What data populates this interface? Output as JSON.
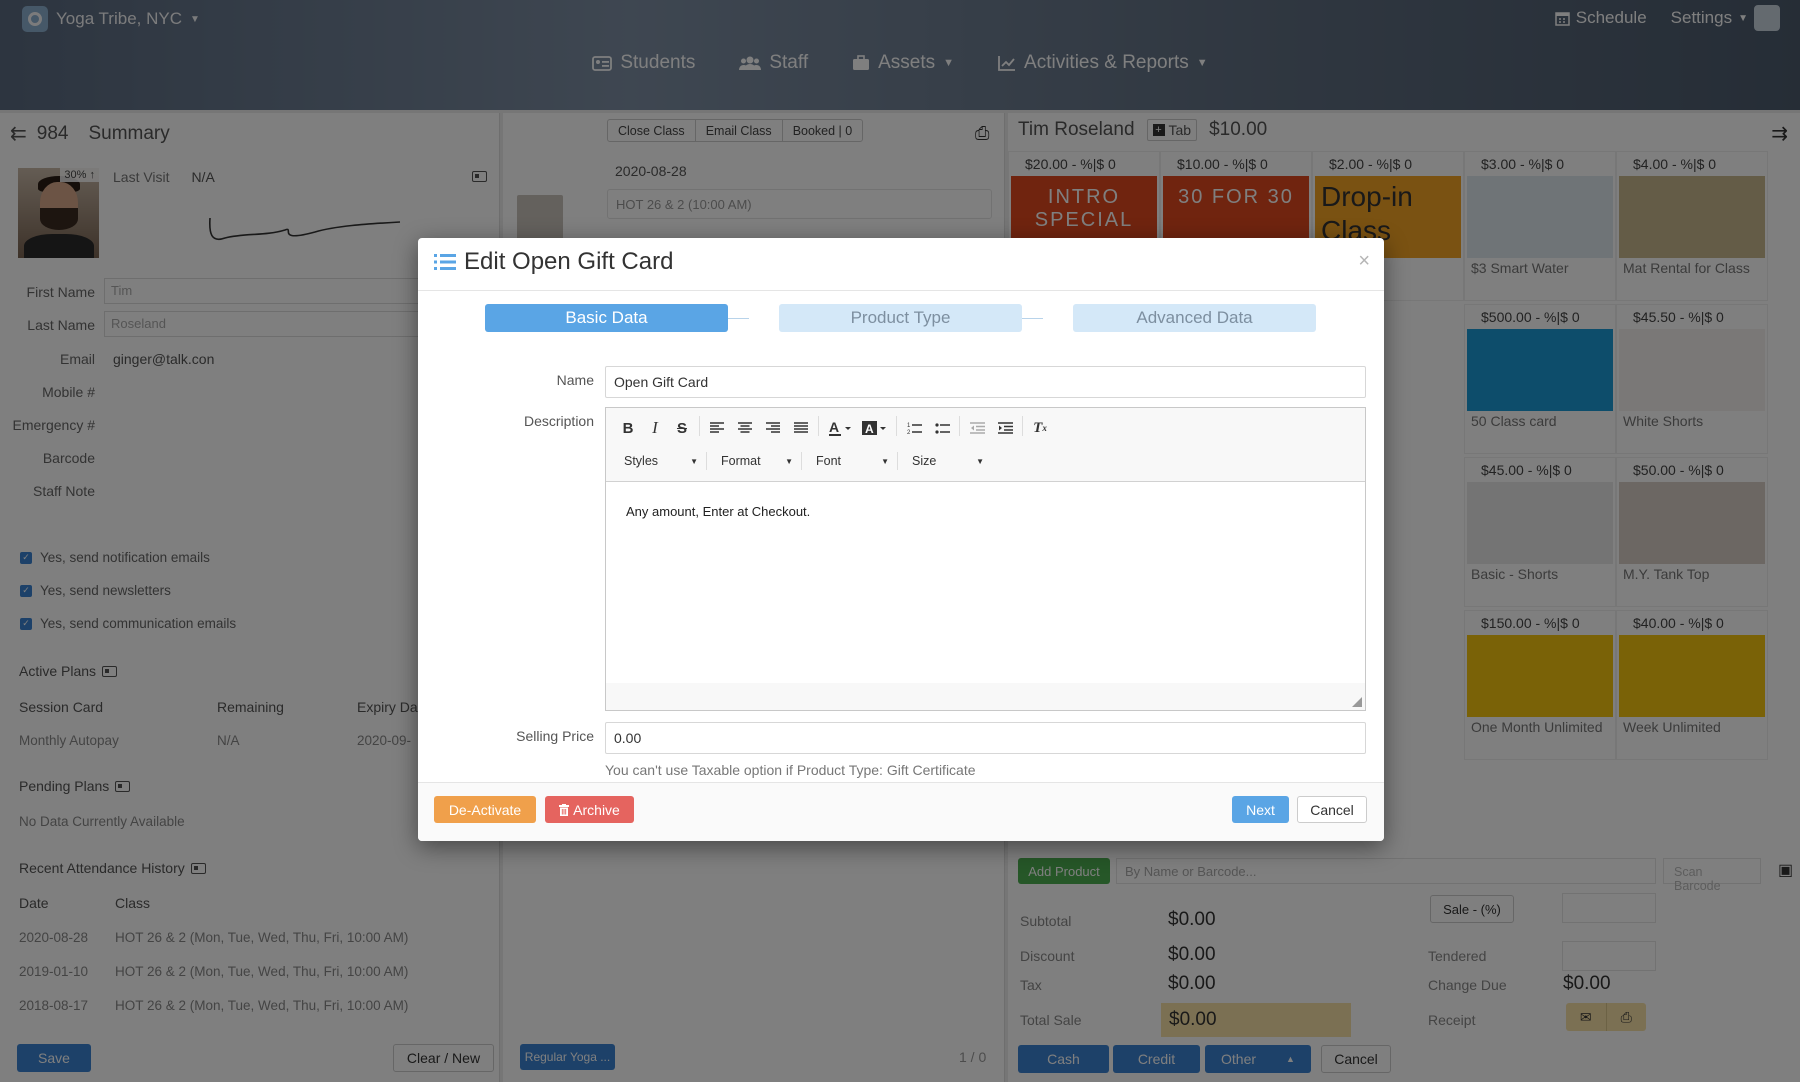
{
  "app": {
    "studio": "Yoga Tribe, NYC",
    "nav": [
      "Students",
      "Staff",
      "Assets",
      "Activities & Reports"
    ],
    "schedule": "Schedule",
    "settings": "Settings"
  },
  "left": {
    "count": "984",
    "title": "Summary",
    "photo_badge": "30%",
    "last_visit_label": "Last Visit",
    "last_visit_value": "N/A",
    "fields": [
      {
        "label": "First Name",
        "value": "Tim"
      },
      {
        "label": "Last Name",
        "value": "Roseland"
      },
      {
        "label": "Email",
        "value": "ginger@talk.con"
      },
      {
        "label": "Mobile #",
        "value": ""
      },
      {
        "label": "Emergency #",
        "value": ""
      },
      {
        "label": "Barcode",
        "value": ""
      },
      {
        "label": "Staff Note",
        "value": ""
      }
    ],
    "checks": [
      "Yes, send notification emails",
      "Yes, send newsletters",
      "Yes, send communication emails"
    ],
    "active_plans": "Active Plans",
    "plan_headers": [
      "Session Card",
      "Remaining",
      "Expiry Da"
    ],
    "plan_row": [
      "Monthly Autopay",
      "N/A",
      "2020-09-"
    ],
    "pending_plans": "Pending Plans",
    "pending_empty": "No Data Currently Available",
    "history_title": "Recent Attendance History",
    "history_headers": [
      "Date",
      "Class"
    ],
    "history": [
      {
        "date": "2020-08-28",
        "cls": "HOT 26 & 2 (Mon, Tue, Wed, Thu, Fri, 10:00 AM)"
      },
      {
        "date": "2019-01-10",
        "cls": "HOT 26 & 2 (Mon, Tue, Wed, Thu, Fri, 10:00 AM)"
      },
      {
        "date": "2018-08-17",
        "cls": "HOT 26 & 2 (Mon, Tue, Wed, Thu, Fri, 10:00 AM)"
      }
    ],
    "save": "Save",
    "clear_new": "Clear / New"
  },
  "mid": {
    "close_class": "Close Class",
    "email_class": "Email Class",
    "booked": "Booked | 0",
    "date": "2020-08-28",
    "class_select": "HOT 26 & 2 (10:00 AM)",
    "regular_btn": "Regular Yoga ...",
    "pager": "1 / 0"
  },
  "right": {
    "customer": "Tim Roseland",
    "tab": "Tab",
    "balance": "$10.00",
    "tiles": [
      {
        "price": "$20.00",
        "name": "INTRO SPECIAL"
      },
      {
        "price": "$10.00",
        "name": "30 FOR 30"
      },
      {
        "price": "$2.00",
        "name": "Drop-in Class"
      },
      {
        "price": "$3.00",
        "name": "$3 Smart Water"
      },
      {
        "price": "$4.00",
        "name": "Mat Rental for Class"
      }
    ],
    "row2": [
      {
        "price": "$500.00",
        "name": "50 Class card"
      },
      {
        "price": "$45.50",
        "name": "White Shorts"
      }
    ],
    "row3": [
      {
        "price": "$45.00",
        "name": "Basic - Shorts"
      },
      {
        "price": "$50.00",
        "name": "M.Y. Tank Top"
      }
    ],
    "row4": [
      {
        "price": "$150.00",
        "name": "One Month Unlimited"
      },
      {
        "price": "$40.00",
        "name": "Week Unlimited"
      }
    ],
    "discount_label": "- %|$",
    "qty": "0",
    "add_product": "Add Product",
    "search_placeholder": "By Name or Barcode...",
    "scan": "Scan Barcode",
    "subtotal_label": "Subtotal",
    "subtotal": "$0.00",
    "discount_row_label": "Discount",
    "discount": "$0.00",
    "tax_label": "Tax",
    "tax": "$0.00",
    "total_label": "Total Sale",
    "total": "$0.00",
    "sale_btn": "Sale - (%)",
    "tendered_label": "Tendered",
    "change_label": "Change Due",
    "change": "$0.00",
    "receipt_label": "Receipt",
    "cash": "Cash",
    "credit": "Credit",
    "other": "Other",
    "cancel": "Cancel"
  },
  "modal": {
    "title": "Edit Open Gift Card",
    "steps": [
      "Basic Data",
      "Product Type",
      "Advanced Data"
    ],
    "name_label": "Name",
    "name_value": "Open Gift Card",
    "desc_label": "Description",
    "combos": [
      "Styles",
      "Format",
      "Font",
      "Size"
    ],
    "desc_text": "Any amount, Enter at Checkout.",
    "price_label": "Selling Price",
    "price_value": "0.00",
    "hint": "You can't use Taxable option if Product Type: Gift Certificate",
    "deactivate": "De-Activate",
    "archive": "Archive",
    "next": "Next",
    "cancel": "Cancel"
  },
  "colors": {
    "primary": "#5aa5e5",
    "step_idle": "#d4e8f8",
    "deactivate": "#f0a04b",
    "archive": "#e5645f",
    "next": "#5aa5e5"
  }
}
